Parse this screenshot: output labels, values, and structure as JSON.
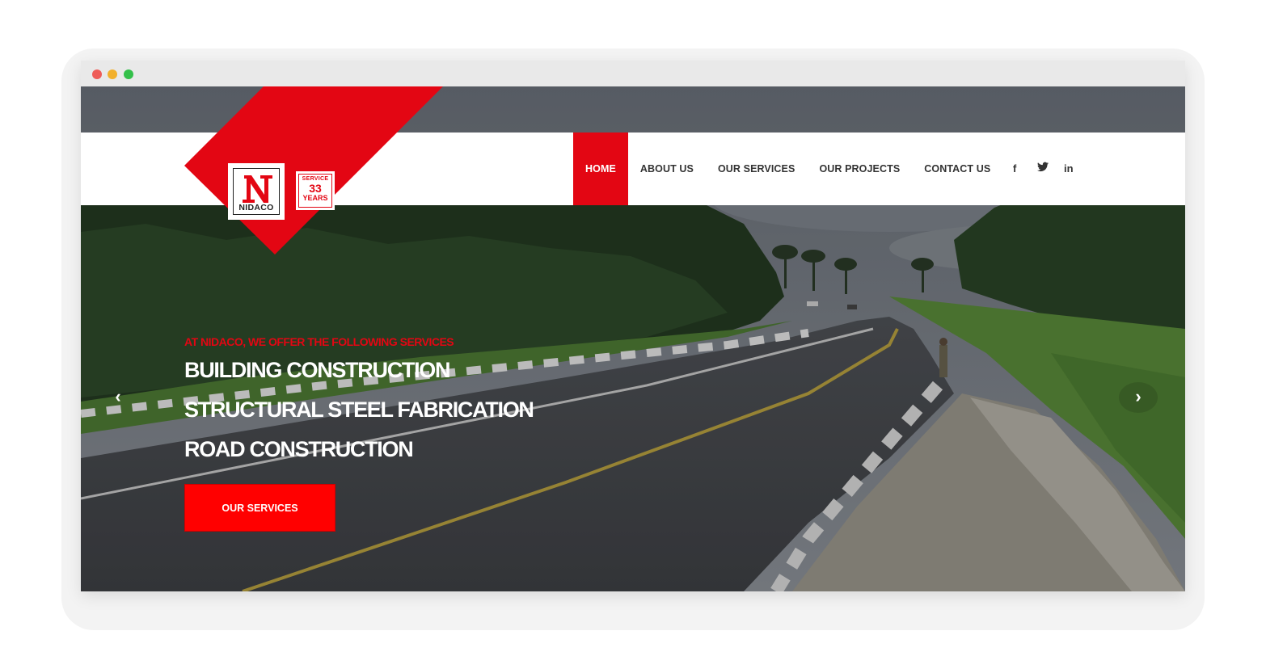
{
  "window": {
    "controls": [
      "close",
      "minimize",
      "maximize"
    ]
  },
  "logo": {
    "name": "NIDACO",
    "badge_top": "SERVICE",
    "badge_number": "33",
    "badge_bottom": "YEARS"
  },
  "nav": {
    "items": [
      {
        "label": "HOME",
        "active": true
      },
      {
        "label": "ABOUT US",
        "active": false
      },
      {
        "label": "OUR SERVICES",
        "active": false
      },
      {
        "label": "OUR PROJECTS",
        "active": false
      },
      {
        "label": "CONTACT US",
        "active": false
      }
    ]
  },
  "social": {
    "facebook": "f",
    "twitter_icon": "twitter-icon",
    "linkedin": "in"
  },
  "hero": {
    "kicker": "AT NIDACO, WE OFFER THE FOLLOWING SERVICES",
    "lines": [
      "BUILDING CONSTRUCTION",
      "STRUCTURAL STEEL FABRICATION",
      "ROAD CONSTRUCTION"
    ],
    "cta_label": "OUR SERVICES",
    "prev_arrow": "‹",
    "next_arrow": "›"
  },
  "colors": {
    "brand_red": "#e30613",
    "cta_red": "#ff0000",
    "nav_text": "#333333"
  }
}
